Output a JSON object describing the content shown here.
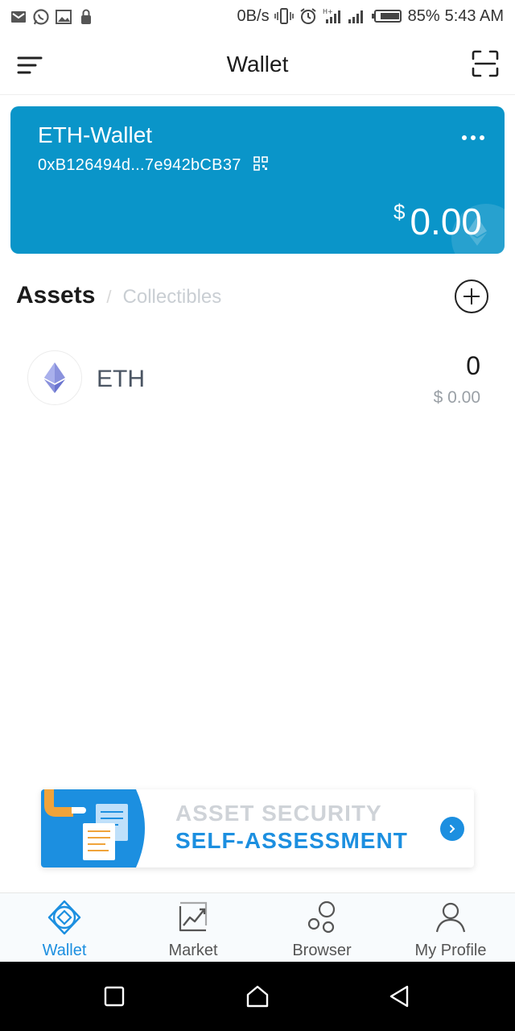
{
  "status_bar": {
    "net_speed": "0B/s",
    "battery": "85%",
    "time": "5:43 AM"
  },
  "header": {
    "title": "Wallet"
  },
  "wallet_card": {
    "name": "ETH-Wallet",
    "address": "0xB126494d...7e942bCB37",
    "currency_symbol": "$",
    "balance": "0.00",
    "color": "#0a95c9"
  },
  "tabs": {
    "active": "Assets",
    "separator": "/",
    "inactive": "Collectibles"
  },
  "assets": [
    {
      "symbol": "ETH",
      "balance": "0",
      "fiat": "$ 0.00"
    }
  ],
  "banner": {
    "line1": "ASSET SECURITY",
    "line2": "SELF-ASSESSMENT"
  },
  "bottom_nav": [
    {
      "label": "Wallet",
      "icon": "wallet-icon",
      "active": true
    },
    {
      "label": "Market",
      "icon": "market-chart-icon",
      "active": false
    },
    {
      "label": "Browser",
      "icon": "browser-bubbles-icon",
      "active": false
    },
    {
      "label": "My Profile",
      "icon": "profile-icon",
      "active": false
    }
  ],
  "accent_color": "#1c8fe0"
}
